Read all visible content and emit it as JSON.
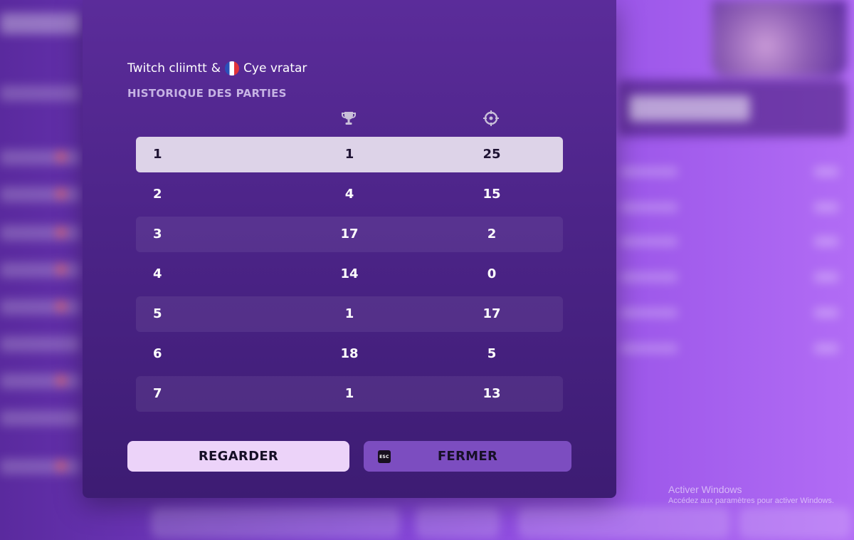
{
  "modal": {
    "player_left": "Twitch cliimtt",
    "separator": "&",
    "player_right": "Cye vratar",
    "section_title": "HISTORIQUE DES PARTIES",
    "columns": [
      {
        "icon": "trophy-icon"
      },
      {
        "icon": "crosshair-icon"
      }
    ],
    "rows": [
      {
        "game": "1",
        "placement": "1",
        "eliminations": "25",
        "highlighted": true
      },
      {
        "game": "2",
        "placement": "4",
        "eliminations": "15"
      },
      {
        "game": "3",
        "placement": "17",
        "eliminations": "2"
      },
      {
        "game": "4",
        "placement": "14",
        "eliminations": "0"
      },
      {
        "game": "5",
        "placement": "1",
        "eliminations": "17"
      },
      {
        "game": "6",
        "placement": "18",
        "eliminations": "5"
      },
      {
        "game": "7",
        "placement": "1",
        "eliminations": "13"
      }
    ],
    "buttons": {
      "watch_label": "REGARDER",
      "close_label": "FERMER",
      "esc_key": "ESC"
    }
  },
  "watermark": {
    "title": "Activer Windows",
    "subtitle": "Accédez aux paramètres pour activer Windows."
  },
  "colors": {
    "modal_top": "#5b2c9a",
    "modal_bottom": "#3d1c73",
    "highlight_row": "#ddd3e8",
    "watch_button": "#ecd3f9",
    "close_button": "#7c4dc0",
    "section_title": "#c6b3e4"
  }
}
